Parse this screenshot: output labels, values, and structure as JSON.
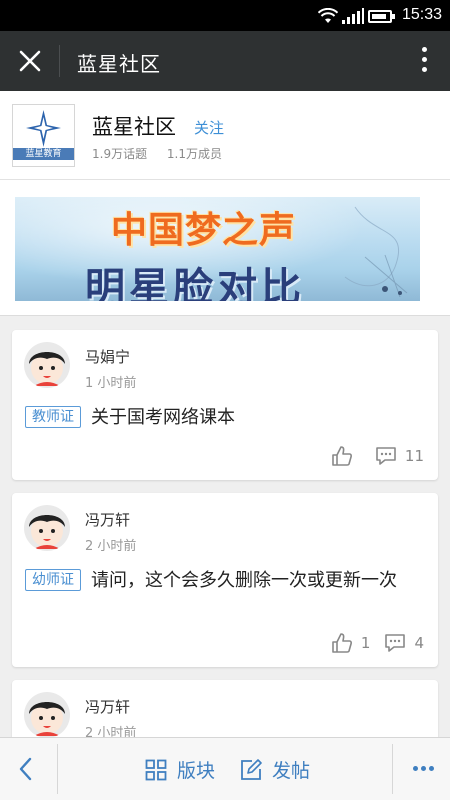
{
  "status_bar": {
    "time": "15:33"
  },
  "app_bar": {
    "title": "蓝星社区"
  },
  "community": {
    "logo_text": "蓝星教育",
    "name": "蓝星社区",
    "follow_label": "关注",
    "topics": "1.9万话题",
    "members": "1.1万成员"
  },
  "banner": {
    "line1": "中国梦之声",
    "line2": "明星脸对比"
  },
  "posts": [
    {
      "author": "马娟宁",
      "time": "1 小时前",
      "tag": "教师证",
      "text": "关于国考网络课本",
      "likes": "",
      "comments": "11"
    },
    {
      "author": "冯万轩",
      "time": "2 小时前",
      "tag": "幼师证",
      "text": "请问，这个会多久删除一次或更新一次",
      "likes": "1",
      "comments": "4"
    },
    {
      "author": "冯万轩",
      "time": "2 小时前"
    }
  ],
  "bottom_bar": {
    "sections_label": "版块",
    "post_label": "发帖"
  },
  "colors": {
    "accent": "#3f7fc0",
    "app_bar": "#2e3132",
    "tag": "#4a8fd1"
  }
}
